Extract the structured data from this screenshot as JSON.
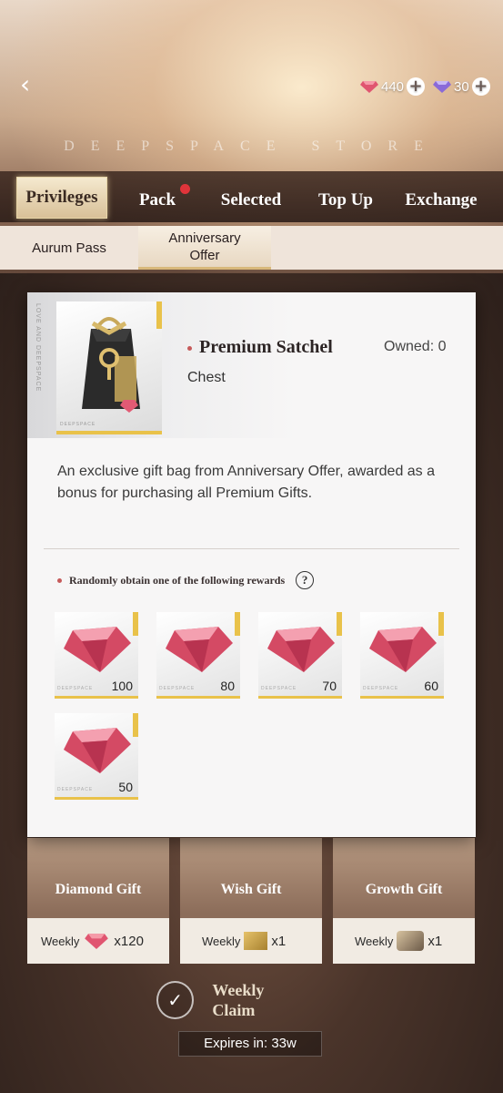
{
  "header": {
    "back_icon": "chevron-left-icon",
    "store_title": "DEEPSPACE STORE",
    "currencies": [
      {
        "icon": "red-diamond-icon",
        "amount": "440"
      },
      {
        "icon": "purple-diamond-icon",
        "amount": "30"
      }
    ]
  },
  "main_tabs": [
    {
      "label": "Privileges",
      "active": true
    },
    {
      "label": "Pack",
      "has_badge": true
    },
    {
      "label": "Selected"
    },
    {
      "label": "Top Up"
    },
    {
      "label": "Exchange"
    }
  ],
  "sub_tabs": [
    {
      "label": "Aurum Pass"
    },
    {
      "label": "Anniversary Offer",
      "active": true
    }
  ],
  "modal": {
    "side_text": "LOVE AND DEEPSPACE",
    "thumb_brand": "DEEPSPACE",
    "item_name": "Premium Satchel",
    "item_type": "Chest",
    "owned": "Owned: 0",
    "description": "An exclusive gift bag from Anniversary Offer, awarded as a bonus for purchasing all Premium Gifts.",
    "rewards_title": "Randomly obtain one of the following rewards",
    "help_icon": "question-icon",
    "rewards": [
      {
        "icon": "red-diamond-icon",
        "qty": "100"
      },
      {
        "icon": "red-diamond-icon",
        "qty": "80"
      },
      {
        "icon": "red-diamond-icon",
        "qty": "70"
      },
      {
        "icon": "red-diamond-icon",
        "qty": "60"
      },
      {
        "icon": "red-diamond-icon",
        "qty": "50"
      }
    ]
  },
  "gifts": [
    {
      "label": "Diamond Gift",
      "period": "Weekly",
      "qty": "x120"
    },
    {
      "label": "Wish Gift",
      "period": "Weekly",
      "qty": "x1"
    },
    {
      "label": "Growth Gift",
      "period": "Weekly",
      "qty": "x1"
    }
  ],
  "claim": {
    "label": "Weekly Claim",
    "expires": "Expires in: 33w"
  },
  "colors": {
    "accent_gold": "#e9c24a",
    "badge_red": "#e0343a",
    "bullet": "#c65a5a"
  }
}
